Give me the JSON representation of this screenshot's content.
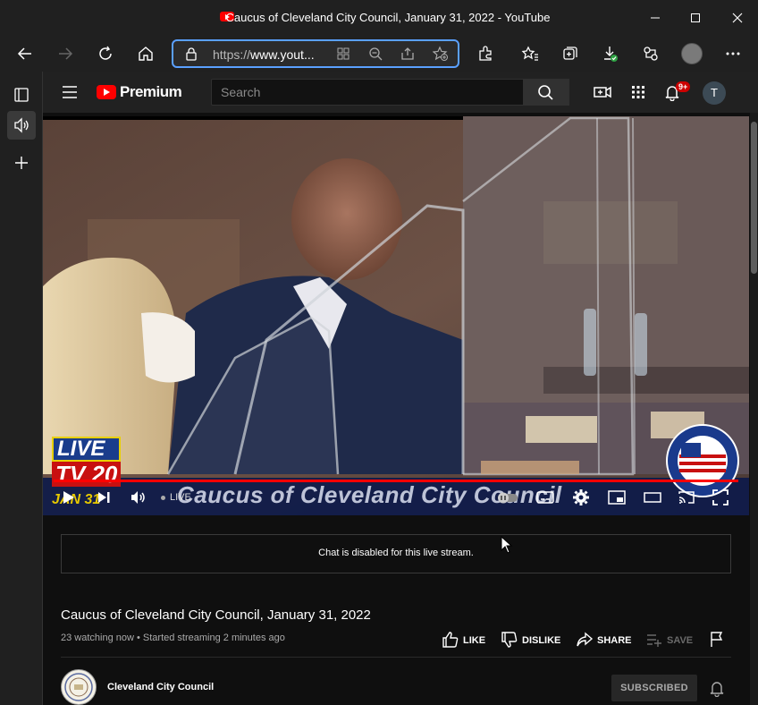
{
  "window": {
    "title": "Caucus of Cleveland City Council, January 31, 2022 - YouTube"
  },
  "browser": {
    "url_prefix": "https://",
    "url_host": "www.yout...",
    "icons": [
      "back-icon",
      "forward-icon",
      "refresh-icon",
      "home-icon",
      "lock-icon",
      "app-available-icon",
      "zoom-out-icon",
      "share-icon",
      "add-favorite-icon",
      "extensions-icon",
      "favorites-icon",
      "collections-icon",
      "downloads-icon",
      "performance-icon",
      "profile-icon",
      "more-icon"
    ]
  },
  "sidebar": {
    "icons": [
      "tab-actions-icon",
      "speaker-icon",
      "add-icon"
    ]
  },
  "youtube": {
    "logo_text": "Premium",
    "search_placeholder": "Search",
    "notification_count": "9+",
    "avatar_letter": "T"
  },
  "video": {
    "overlay_chyron": "Caucus of Cleveland City Council",
    "overlay_logo_live": "LIVE",
    "overlay_logo_tv": "TV 20",
    "overlay_date": "JAN 31",
    "live_label": "LIVE",
    "progress_percent": 100
  },
  "chat": {
    "message": "Chat is disabled for this live stream."
  },
  "details": {
    "title": "Caucus of Cleveland City Council, January 31, 2022",
    "meta": "23 watching now • Started streaming 2 minutes ago",
    "like_label": "LIKE",
    "dislike_label": "DISLIKE",
    "share_label": "SHARE",
    "save_label": "SAVE"
  },
  "channel": {
    "name": "Cleveland City Council",
    "subscribe_label": "SUBSCRIBED"
  },
  "colors": {
    "brand_red": "#ff0000",
    "address_focus": "#5aa0ff",
    "bg": "#0f0f0f"
  }
}
